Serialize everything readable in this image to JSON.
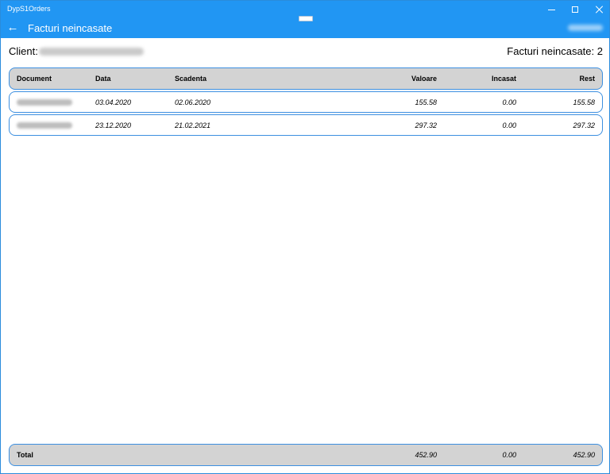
{
  "window": {
    "app_title": "DypS1Orders"
  },
  "header": {
    "back_icon": "←",
    "title": "Facturi neincasate"
  },
  "client": {
    "label": "Client:"
  },
  "summary": {
    "label": "Facturi neincasate:",
    "count": "2"
  },
  "table": {
    "columns": [
      "Document",
      "Data",
      "Scadenta",
      "Valoare",
      "Incasat",
      "Rest"
    ],
    "rows": [
      {
        "data": "03.04.2020",
        "scadenta": "02.06.2020",
        "valoare": "155.58",
        "incasat": "0.00",
        "rest": "155.58"
      },
      {
        "data": "23.12.2020",
        "scadenta": "21.02.2021",
        "valoare": "297.32",
        "incasat": "0.00",
        "rest": "297.32"
      }
    ],
    "total": {
      "label": "Total",
      "valoare": "452.90",
      "incasat": "0.00",
      "rest": "452.90"
    }
  },
  "colors": {
    "accent": "#2196f3",
    "border": "#3c8fe0",
    "header_bg": "#d3d3d3"
  }
}
